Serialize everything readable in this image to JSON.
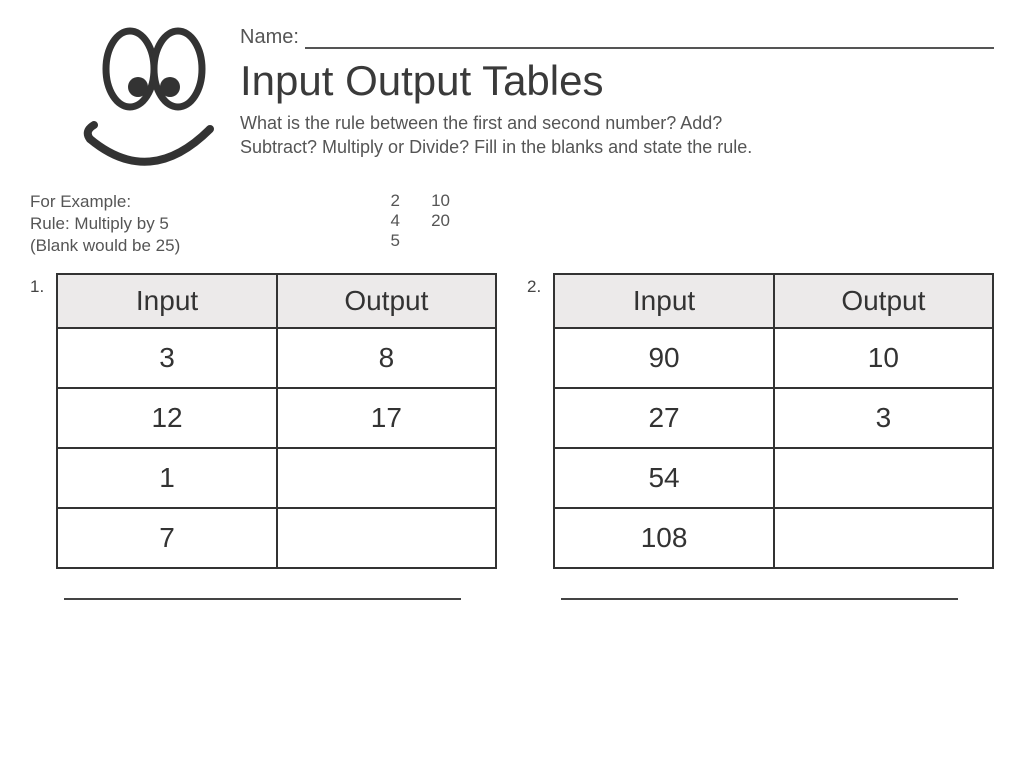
{
  "name_label": "Name:",
  "title": "Input Output Tables",
  "subtitle_line1": "What is the rule between the first and second number? Add?",
  "subtitle_line2": "Subtract? Multiply or Divide? Fill in the blanks and state the rule.",
  "example": {
    "label1": "For Example:",
    "label2": "Rule: Multiply by 5",
    "label3": "(Blank would be 25)",
    "pairs": [
      {
        "in": "2",
        "out": "10"
      },
      {
        "in": "4",
        "out": "20"
      },
      {
        "in": "5",
        "out": ""
      }
    ]
  },
  "headers": {
    "input": "Input",
    "output": "Output"
  },
  "tables": [
    {
      "num": "1.",
      "rows": [
        {
          "in": "3",
          "out": "8"
        },
        {
          "in": "12",
          "out": "17"
        },
        {
          "in": "1",
          "out": ""
        },
        {
          "in": "7",
          "out": ""
        }
      ]
    },
    {
      "num": "2.",
      "rows": [
        {
          "in": "90",
          "out": "10"
        },
        {
          "in": "27",
          "out": "3"
        },
        {
          "in": "54",
          "out": ""
        },
        {
          "in": "108",
          "out": ""
        }
      ]
    }
  ]
}
